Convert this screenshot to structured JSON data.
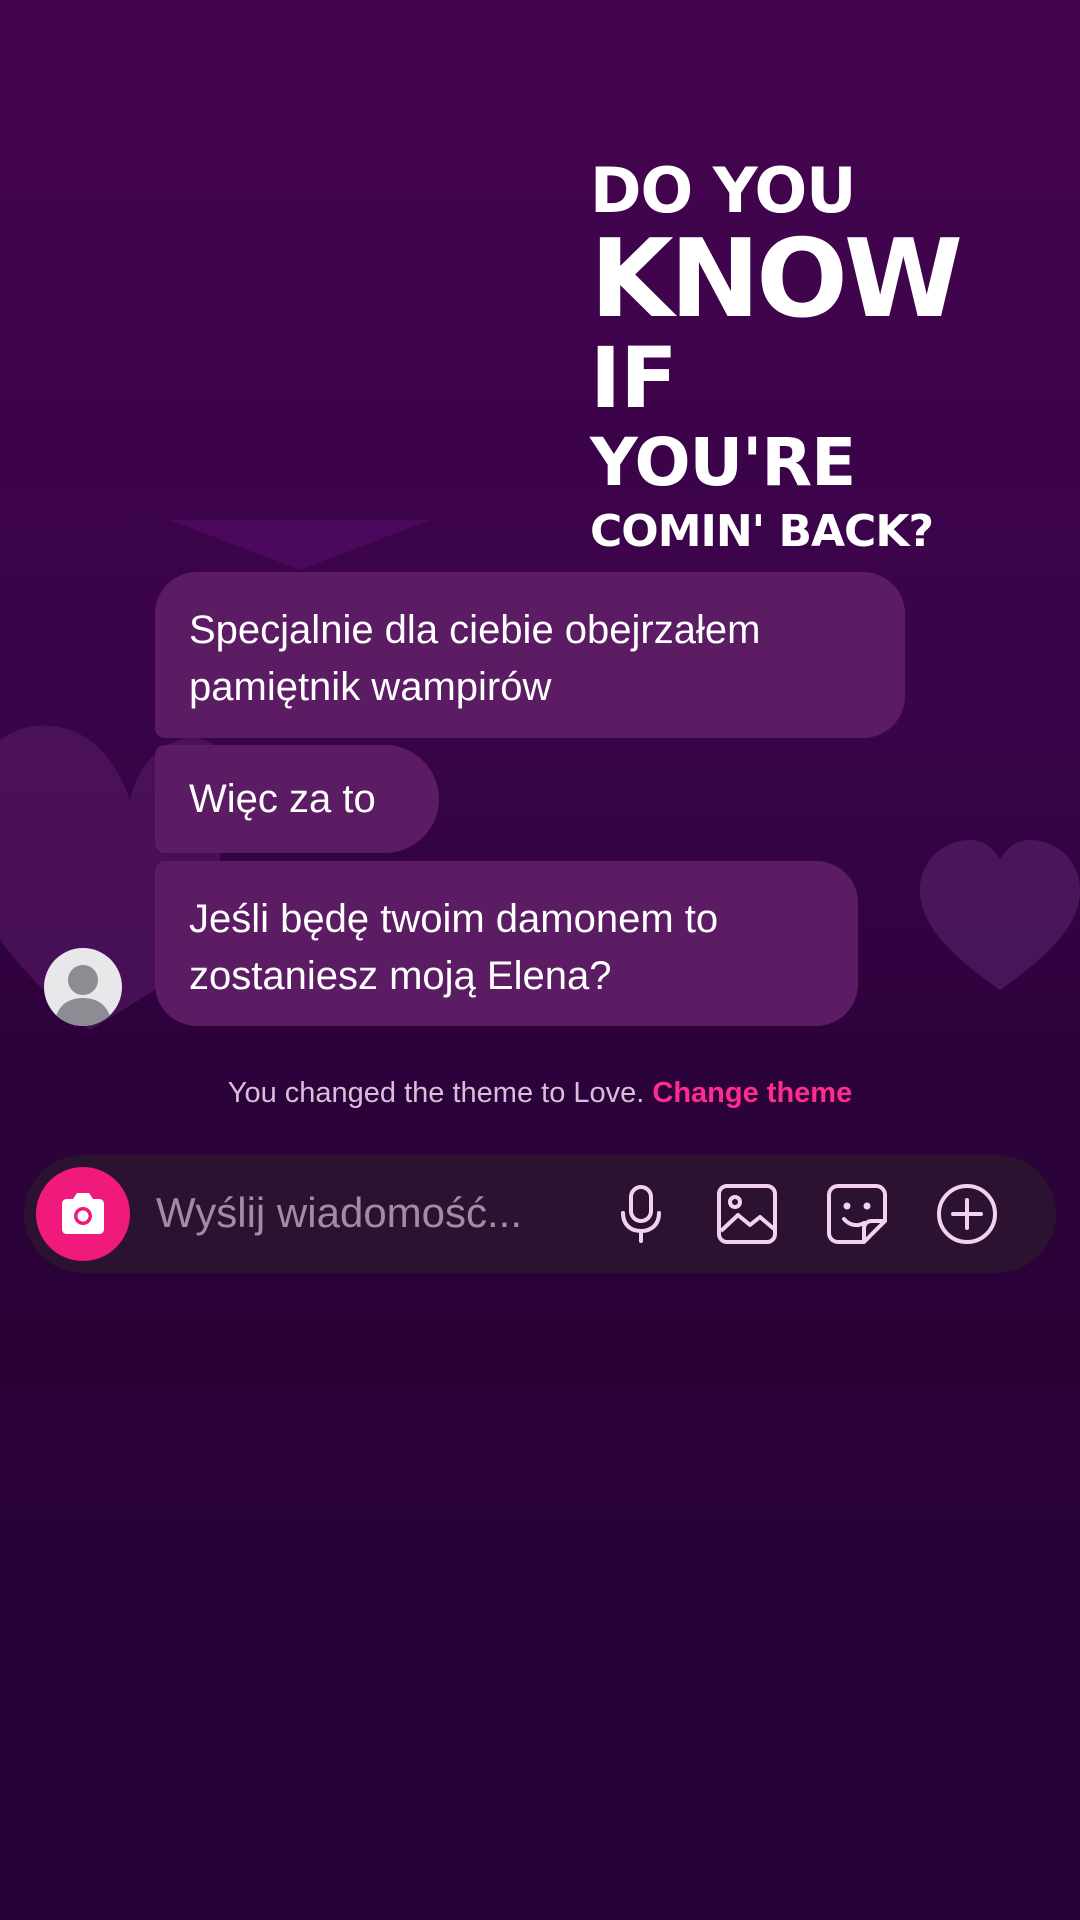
{
  "overlay_caption": {
    "line1": "DO YOU",
    "line2": "KNOW",
    "line3": "IF",
    "line4": "YOU'RE",
    "line5": "COMIN' BACK?"
  },
  "messages": [
    {
      "lines": [
        "Specjalnie dla ciebie obejrzałem",
        "pamiętnik wampirów"
      ]
    },
    {
      "lines": [
        "Więc za to"
      ]
    },
    {
      "lines": [
        "Jeśli będę twoim damonem to",
        "zostaniesz moją Elena?"
      ]
    }
  ],
  "system_message": {
    "text": "You changed the theme to Love.",
    "link": "Change theme"
  },
  "composer": {
    "placeholder": "Wyślij wiadomość..."
  },
  "icons": {
    "camera": "camera-icon",
    "microphone": "microphone-icon",
    "gallery": "gallery-icon",
    "sticker": "sticker-icon",
    "add": "plus-circle-icon"
  },
  "colors": {
    "bubble": "#5c1c63",
    "accent": "#ef1a7c",
    "link": "#ff2c8e",
    "background_top": "#44054f",
    "background_bottom": "#2a0139"
  }
}
